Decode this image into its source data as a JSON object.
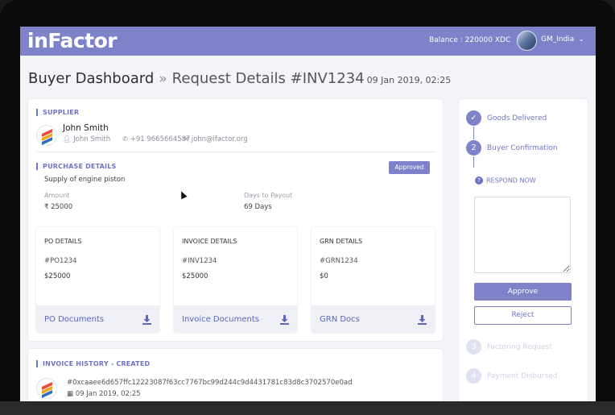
{
  "app": {
    "brand": "inFactor",
    "balance": "Balance : 220000 XDC",
    "user": "GM_India",
    "accent": "#7d82c9"
  },
  "header": {
    "section": "Buyer Dashboard",
    "separator": "»",
    "request": "Request Details #INV1234",
    "date": "09 Jan 2019, 02:25"
  },
  "supplier": {
    "label": "SUPPLIER",
    "name": "John Smith",
    "contact_name": "John Smith",
    "phone": "+91 9665664587",
    "email": "john@ifactor.org",
    "icons": [
      "user-icon",
      "phone-icon",
      "envelope-icon"
    ]
  },
  "purchase": {
    "label": "PURCHASE DETAILS",
    "status": "Approved",
    "description": "Supply of engine piston",
    "amount_label": "Amount",
    "amount": "₹ 25000",
    "days_label": "Days to Payout",
    "days": "69 Days"
  },
  "details": [
    {
      "title": "PO DETAILS",
      "number": "#PO1234",
      "amount": "$25000",
      "doc": "PO Documents"
    },
    {
      "title": "INVOICE DETAILS",
      "number": "#INV1234",
      "amount": "$25000",
      "doc": "Invoice Documents"
    },
    {
      "title": "GRN DETAILS",
      "number": "#GRN1234",
      "amount": "$0",
      "doc": "GRN Docs"
    }
  ],
  "history": {
    "label": "INVOICE HISTORY - CREATED",
    "hash": "#0xcaaee6d657ffc12223087f63cc7767bc99d244c9d4431781c83d8c3702570e0ad",
    "date": "09 Jan 2019, 02:25"
  },
  "steps": [
    {
      "marker": "✓",
      "label": "Goods Delivered",
      "state": "done"
    },
    {
      "marker": "2",
      "label": "Buyer Confirmation",
      "state": "active"
    },
    {
      "marker": "3",
      "label": "Factoring Request",
      "state": "pending"
    },
    {
      "marker": "4",
      "label": "Payment Disbursed",
      "state": "pending"
    }
  ],
  "respond": {
    "icon": "?",
    "label": "RESPOND NOW",
    "text": "",
    "approve": "Approve",
    "reject": "Reject"
  }
}
